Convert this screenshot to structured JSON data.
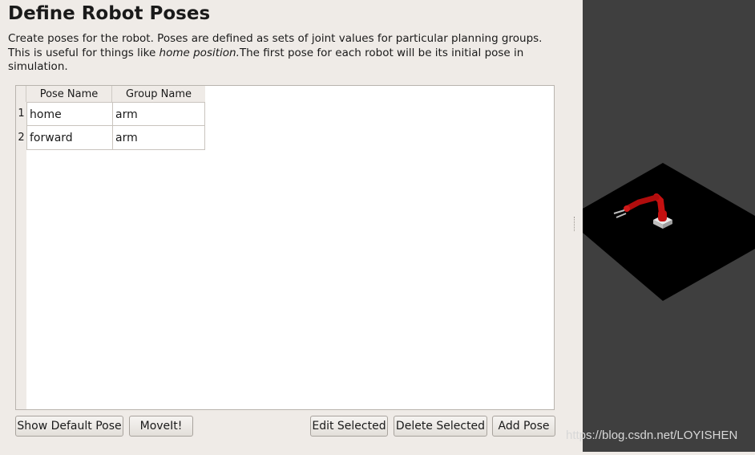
{
  "page": {
    "title": "Define Robot Poses",
    "description_part1": "Create poses for the robot. Poses are defined as sets of joint values for particular planning groups. This is useful for things like ",
    "description_italic": "home position.",
    "description_part2": "The first pose for each robot will be its initial pose in simulation."
  },
  "table": {
    "columns": [
      "Pose Name",
      "Group Name"
    ],
    "rows": [
      {
        "index": "1",
        "pose_name": "home",
        "group_name": "arm"
      },
      {
        "index": "2",
        "pose_name": "forward",
        "group_name": "arm"
      }
    ]
  },
  "buttons": {
    "show_default_pose": "Show Default Pose",
    "moveit": "MoveIt!",
    "edit_selected": "Edit Selected",
    "delete_selected": "Delete Selected",
    "add_pose": "Add Pose"
  },
  "viewer": {
    "background": "#3f3f3f",
    "floor_color": "#000000",
    "robot_color": "#c41010"
  },
  "watermark": "https://blog.csdn.net/LOYISHEN"
}
